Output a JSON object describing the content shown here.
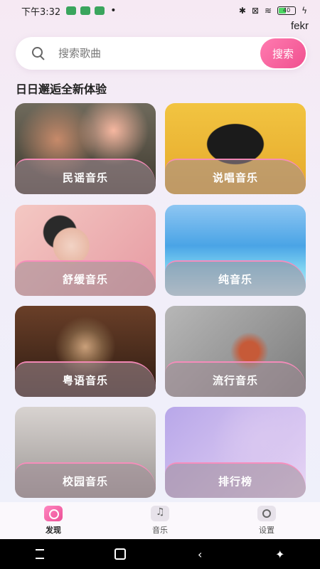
{
  "statusbar": {
    "time": "下午3:32",
    "battery": "40"
  },
  "header": {
    "username": "fekr"
  },
  "search": {
    "placeholder": "搜索歌曲",
    "button": "搜索"
  },
  "section": {
    "title": "日日邂逅全新体验"
  },
  "categories": [
    {
      "label": "民谣音乐",
      "art": "folk-band"
    },
    {
      "label": "说唱音乐",
      "art": "hiphop-graffiti"
    },
    {
      "label": "舒缓音乐",
      "art": "headphones-woman"
    },
    {
      "label": "纯音乐",
      "art": "piano-on-water"
    },
    {
      "label": "粤语音乐",
      "art": "studio-microphone"
    },
    {
      "label": "流行音乐",
      "art": "electric-guitar"
    },
    {
      "label": "校园音乐",
      "art": "sheet-music"
    },
    {
      "label": "排行榜",
      "art": "violin"
    }
  ],
  "tabs": [
    {
      "label": "发现",
      "icon": "discover-icon",
      "active": true
    },
    {
      "label": "音乐",
      "icon": "music-note-icon",
      "active": false
    },
    {
      "label": "设置",
      "icon": "settings-icon",
      "active": false
    }
  ],
  "colors": {
    "accent": "#f0508f",
    "background": "#f2eef9"
  }
}
